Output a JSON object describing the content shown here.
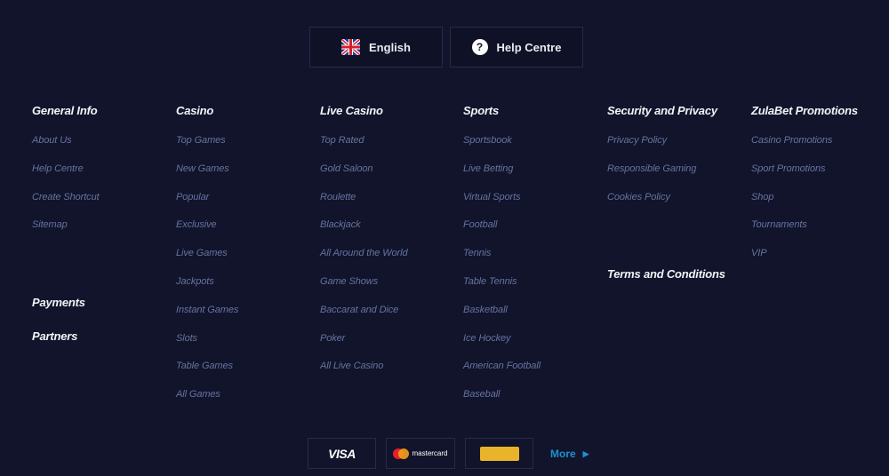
{
  "top_buttons": {
    "language": "English",
    "help": "Help Centre"
  },
  "columns": [
    {
      "title": "General Info",
      "links": [
        "About Us",
        "Help Centre",
        "Create Shortcut",
        "Sitemap"
      ]
    },
    {
      "title": "Casino",
      "links": [
        "Top Games",
        "New Games",
        "Popular",
        "Exclusive",
        "Live Games",
        "Jackpots",
        "Instant Games",
        "Slots",
        "Table Games",
        "All Games"
      ]
    },
    {
      "title": "Live Casino",
      "links": [
        "Top Rated",
        "Gold Saloon",
        "Roulette",
        "Blackjack",
        "All Around the World",
        "Game Shows",
        "Baccarat and Dice",
        "Poker",
        "All Live Casino"
      ]
    },
    {
      "title": "Sports",
      "links": [
        "Sportsbook",
        "Live Betting",
        "Virtual Sports",
        "Football",
        "Tennis",
        "Table Tennis",
        "Basketball",
        "Ice Hockey",
        "American Football",
        "Baseball"
      ]
    },
    {
      "title": "Security and Privacy",
      "links": [
        "Privacy Policy",
        "Responsible Gaming",
        "Cookies Policy"
      ]
    },
    {
      "title": "ZulaBet Promotions",
      "links": [
        "Casino Promotions",
        "Sport Promotions",
        "Shop",
        "Tournaments",
        "VIP"
      ]
    }
  ],
  "extra_links": {
    "payments": "Payments",
    "partners": "Partners",
    "terms": "Terms and Conditions"
  },
  "payments": {
    "visa": "VISA",
    "mastercard": "mastercard",
    "more": "More"
  },
  "colors": {
    "background": "#11142a",
    "link": "#6673a0",
    "more": "#1e8fd6",
    "badge": "#e9b42a"
  }
}
